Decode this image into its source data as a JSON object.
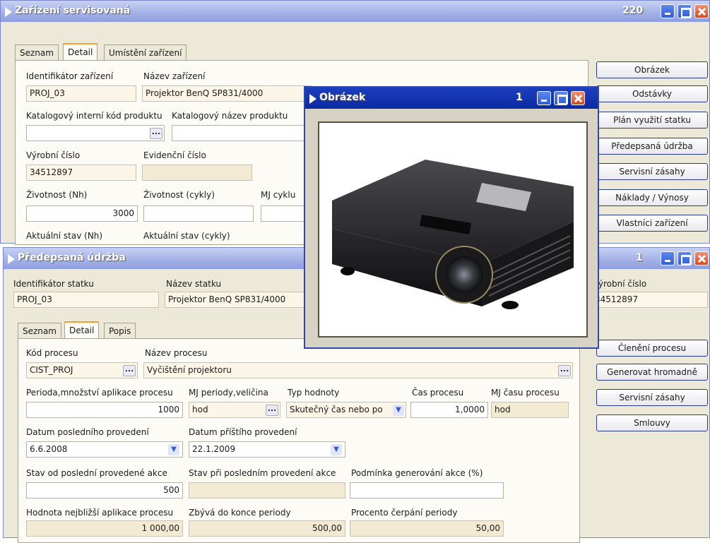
{
  "win1": {
    "title": "Zařízení servisovaná",
    "count": "220",
    "tabs": [
      "Seznam",
      "Detail",
      "Umístění zařízení"
    ],
    "labels": {
      "id": "Identifikátor zařízení",
      "name": "Název zařízení",
      "catcode": "Katalogový interní kód produktu",
      "catname": "Katalogový název produktu",
      "serial": "Výrobní číslo",
      "evid": "Evidenční číslo",
      "life_nh": "Životnost (Nh)",
      "life_cyc": "Životnost (cykly)",
      "mj": "MJ cyklu",
      "cur_nh": "Aktuální stav (Nh)",
      "cur_cyc": "Aktuální stav (cykly)"
    },
    "values": {
      "id": "PROJ_03",
      "name": "Projektor BenQ SP831/4000",
      "serial": "34512897",
      "life_nh": "3000"
    },
    "buttons": [
      "Obrázek",
      "Odstávky",
      "Plán využití statku",
      "Předepsaná údržba",
      "Servisní zásahy",
      "Náklady / Výnosy",
      "Vlastníci zařízení"
    ]
  },
  "win2": {
    "title": "Předepsaná údržba",
    "count": "1",
    "labels": {
      "id": "Identifikátor statku",
      "name": "Název statku",
      "serial": "Výrobní číslo"
    },
    "values": {
      "id": "PROJ_03",
      "name": "Projektor BenQ SP831/4000",
      "serial": "34512897"
    },
    "tabs": [
      "Seznam",
      "Detail",
      "Popis"
    ],
    "form": {
      "kod_l": "Kód procesu",
      "kod_v": "CIST_PROJ",
      "nazev_l": "Název procesu",
      "nazev_v": "Vyčištění projektoru",
      "per_l": "Perioda,množství aplikace procesu",
      "per_v": "1000",
      "mj_l": "MJ periody,veličina",
      "mj_v": "hod",
      "typ_l": "Typ hodnoty",
      "typ_v": "Skutečný čas nebo po",
      "cas_l": "Čas procesu",
      "cas_v": "1,0000",
      "mjc_l": "MJ času procesu",
      "mjc_v": "hod",
      "dpp_l": "Datum posledního provedení",
      "dpp_v": "6.6.2008",
      "dnp_l": "Datum příštího provedení",
      "dnp_v": "22.1.2009",
      "sod_l": "Stav od poslední provedené akce",
      "sod_v": "500",
      "spp_l": "Stav při posledním provedení akce",
      "pga_l": "Podmínka generování akce (%)",
      "hna_l": "Hodnota nejbližší aplikace procesu",
      "hna_v": "1 000,00",
      "zdk_l": "Zbývá do konce periody",
      "zdk_v": "500,00",
      "pcp_l": "Procento čerpání periody",
      "pcp_v": "50,00"
    },
    "buttons": [
      "Členění procesu",
      "Generovat hromadně",
      "Servisní zásahy",
      "Smlouvy"
    ]
  },
  "win3": {
    "title": "Obrázek",
    "count": "1",
    "image": "projector-photo"
  },
  "colors": {
    "title_gradient": "#8e9de0",
    "accent": "#f0a030",
    "close": "#d54a20"
  }
}
